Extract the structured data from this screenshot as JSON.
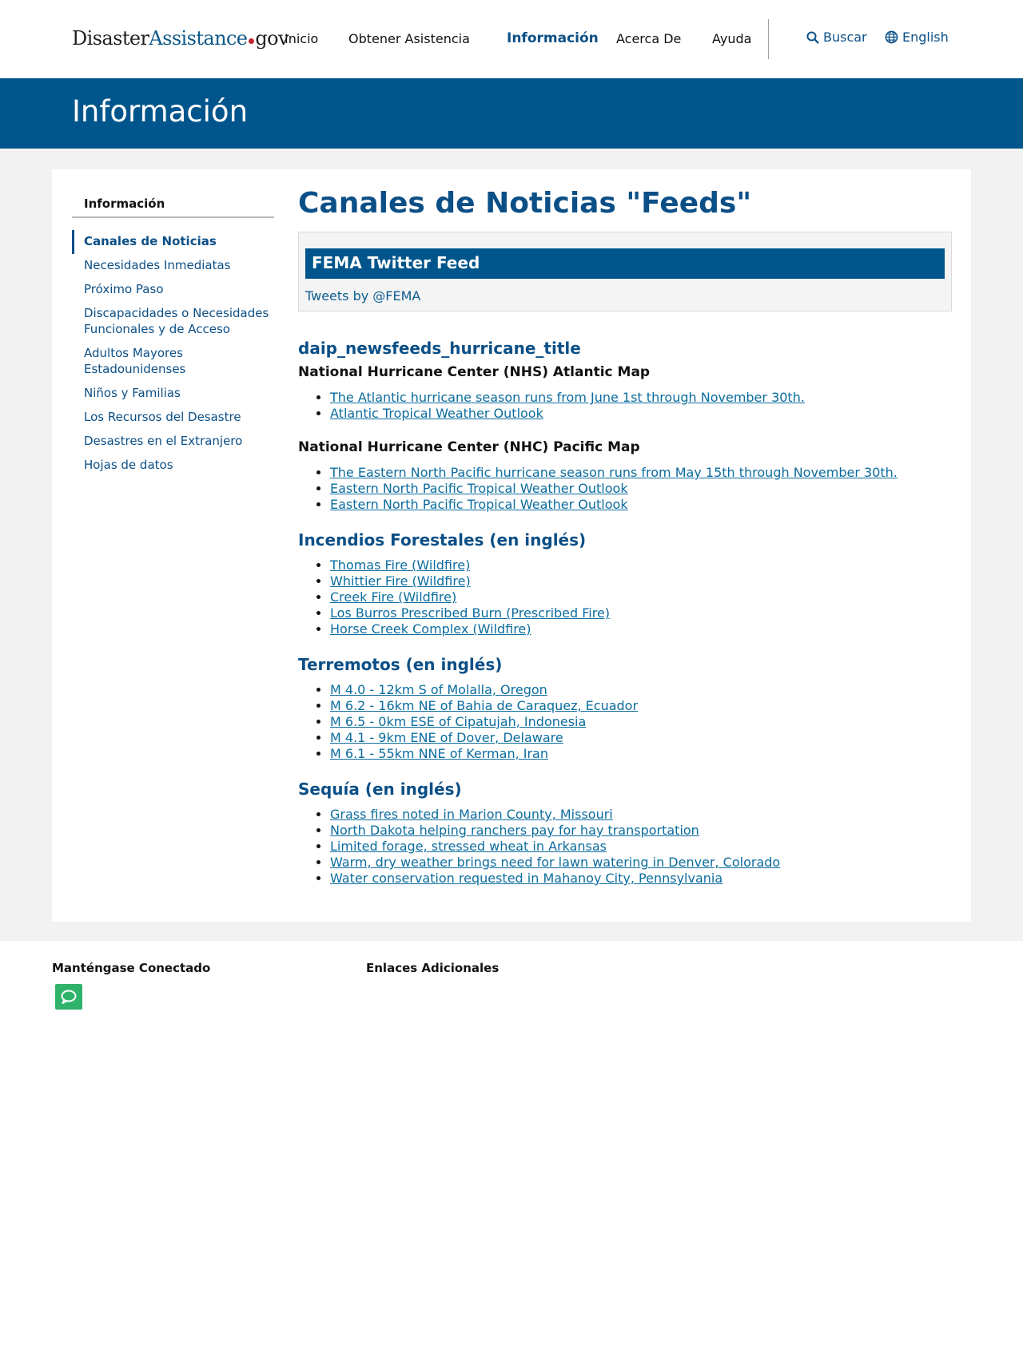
{
  "header": {
    "logo": {
      "part1": "Disaster",
      "part2": "Assistance",
      "part3": "gov"
    },
    "nav": [
      "Inicio",
      "Obtener Asistencia",
      "Información",
      "Acerca De",
      "Ayuda"
    ],
    "active_nav": "Información",
    "search_label": "Buscar",
    "language_label": "English"
  },
  "banner": {
    "title": "Información"
  },
  "sidebar": {
    "title": "Información",
    "items": [
      {
        "label": "Canales de Noticias",
        "active": true
      },
      {
        "label": "Necesidades Inmediatas"
      },
      {
        "label": "Próximo Paso"
      },
      {
        "label": "Discapacidades o Necesidades Funcionales y de Acceso"
      },
      {
        "label": "Adultos Mayores Estadounidenses"
      },
      {
        "label": "Niños y Familias"
      },
      {
        "label": "Los Recursos del Desastre"
      },
      {
        "label": "Desastres en el Extranjero"
      },
      {
        "label": "Hojas de datos"
      }
    ]
  },
  "main": {
    "title": "Canales de Noticias \"Feeds\"",
    "twitter": {
      "heading": "FEMA Twitter Feed",
      "link": "Tweets by @FEMA"
    },
    "hurricane": {
      "title": "daip_newsfeeds_hurricane_title",
      "atlantic_heading": "National Hurricane Center (NHS) Atlantic Map",
      "atlantic_links": [
        "The Atlantic hurricane season runs from June 1st through November 30th.",
        "Atlantic Tropical Weather Outlook"
      ],
      "pacific_heading": "National Hurricane Center (NHC) Pacific Map",
      "pacific_links": [
        "The Eastern North Pacific hurricane season runs from May 15th through November 30th.",
        "Eastern North Pacific Tropical Weather Outlook",
        "Eastern North Pacific Tropical Weather Outlook"
      ]
    },
    "wildfires": {
      "title": "Incendios Forestales (en inglés)",
      "links": [
        "Thomas Fire (Wildfire)",
        "Whittier Fire (Wildfire)",
        "Creek Fire (Wildfire)",
        "Los Burros Prescribed Burn (Prescribed Fire)",
        "Horse Creek Complex (Wildfire)"
      ]
    },
    "earthquakes": {
      "title": "Terremotos (en inglés)",
      "links": [
        "M 4.0 - 12km S of Molalla, Oregon",
        "M 6.2 - 16km NE of Bahia de Caraquez, Ecuador",
        "M 6.5 - 0km ESE of Cipatujah, Indonesia",
        "M 4.1 - 9km ENE of Dover, Delaware",
        "M 6.1 - 55km NNE of Kerman, Iran"
      ]
    },
    "drought": {
      "title": "Sequía (en inglés)",
      "links": [
        "Grass fires noted in Marion County, Missouri",
        "North Dakota helping ranchers pay for hay transportation",
        "Limited forage, stressed wheat in Arkansas",
        "Warm, dry weather brings need for lawn watering in Denver, Colorado",
        "Water conservation requested in Mahanoy City, Pennsylvania"
      ]
    }
  },
  "footer": {
    "connect_heading": "Manténgase Conectado",
    "links_heading": "Enlaces Adicionales",
    "chat_icon": "chat-bubble-icon"
  },
  "colors": {
    "primary": "#00568c",
    "link": "#0b6c9e",
    "chat": "#2fb36b"
  }
}
